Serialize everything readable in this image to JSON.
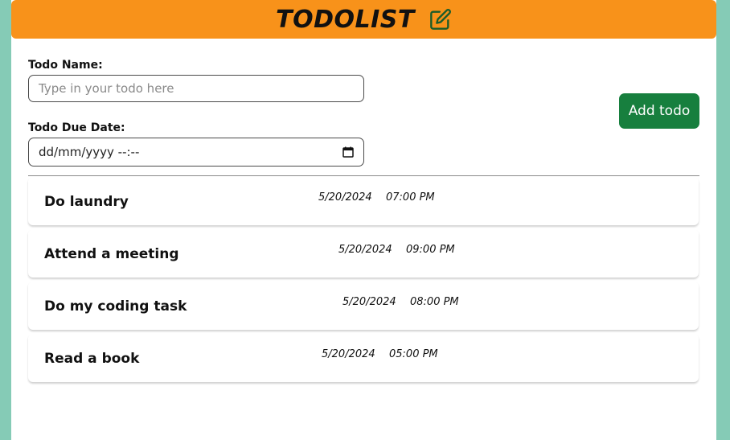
{
  "header": {
    "title": "TODOLIST",
    "icon": "edit-icon",
    "background": "#f8921a"
  },
  "form": {
    "name_label": "Todo Name:",
    "name_placeholder": "Type in your todo here",
    "name_value": "",
    "date_label": "Todo Due Date:",
    "date_display": "dd/mm/yyyy --:--",
    "date_icon": "calendar-icon",
    "add_button_label": "Add todo",
    "add_button_color": "#177f3e"
  },
  "todos": [
    {
      "name": "Do laundry",
      "date": "5/20/2024",
      "time": "07:00 PM"
    },
    {
      "name": "Attend a meeting",
      "date": "5/20/2024",
      "time": "09:00 PM"
    },
    {
      "name": "Do my coding task",
      "date": "5/20/2024",
      "time": "08:00 PM"
    },
    {
      "name": "Read a book",
      "date": "5/20/2024",
      "time": "05:00 PM"
    }
  ],
  "colors": {
    "page_background": "#85cbb6",
    "card_background": "#ffffff"
  }
}
